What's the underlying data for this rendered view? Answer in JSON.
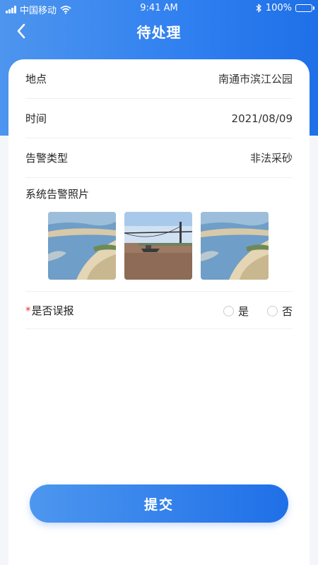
{
  "status_bar": {
    "carrier": "中国移动",
    "time": "9:41 AM",
    "battery": "100%"
  },
  "nav": {
    "title": "待处理",
    "back_icon": "chevron-left-icon"
  },
  "details": [
    {
      "label": "地点",
      "value": "南通市滨江公园"
    },
    {
      "label": "时间",
      "value": "2021/08/09"
    },
    {
      "label": "告警类型",
      "value": "非法采砂"
    }
  ],
  "photos": {
    "title": "系统告警照片",
    "items": [
      "river-beach-photo",
      "bridge-boat-photo",
      "river-beach-photo"
    ]
  },
  "false_alarm": {
    "required_mark": "*",
    "label": "是否误报",
    "options": [
      "是",
      "否"
    ]
  },
  "submit_label": "提交",
  "colors": {
    "accent": "#2f7ff0",
    "required": "#e53935"
  }
}
